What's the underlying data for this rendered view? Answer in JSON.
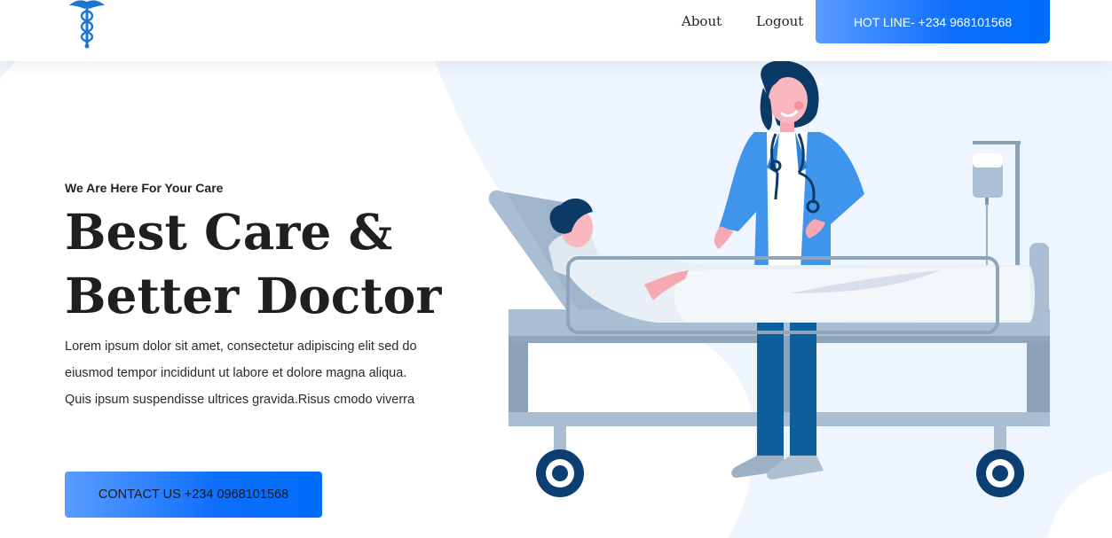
{
  "header": {
    "nav": {
      "about": "About",
      "logout": "Logout"
    },
    "hotline_label": "HOT LINE- +234 968101568"
  },
  "hero": {
    "eyebrow": "We Are Here For Your Care",
    "headline_line1": "Best Care &",
    "headline_line2": "Better Doctor",
    "description_lines": [
      "Lorem ipsum dolor sit amet, consectetur adipiscing elit sed do",
      "eiusmod tempor incididunt ut labore et dolore magna aliqua.",
      "Quis ipsum suspendisse ultrices gravida.Risus cmodo viverra"
    ],
    "contact_label": "CONTACT US +234 0968101568"
  },
  "icons": {
    "logo": "caduceus-icon"
  },
  "colors": {
    "accent": "#0d6efd",
    "accent_light": "#5a9cff",
    "hero_bg": "#eef5ff",
    "text_dark": "#1f1f1f"
  }
}
